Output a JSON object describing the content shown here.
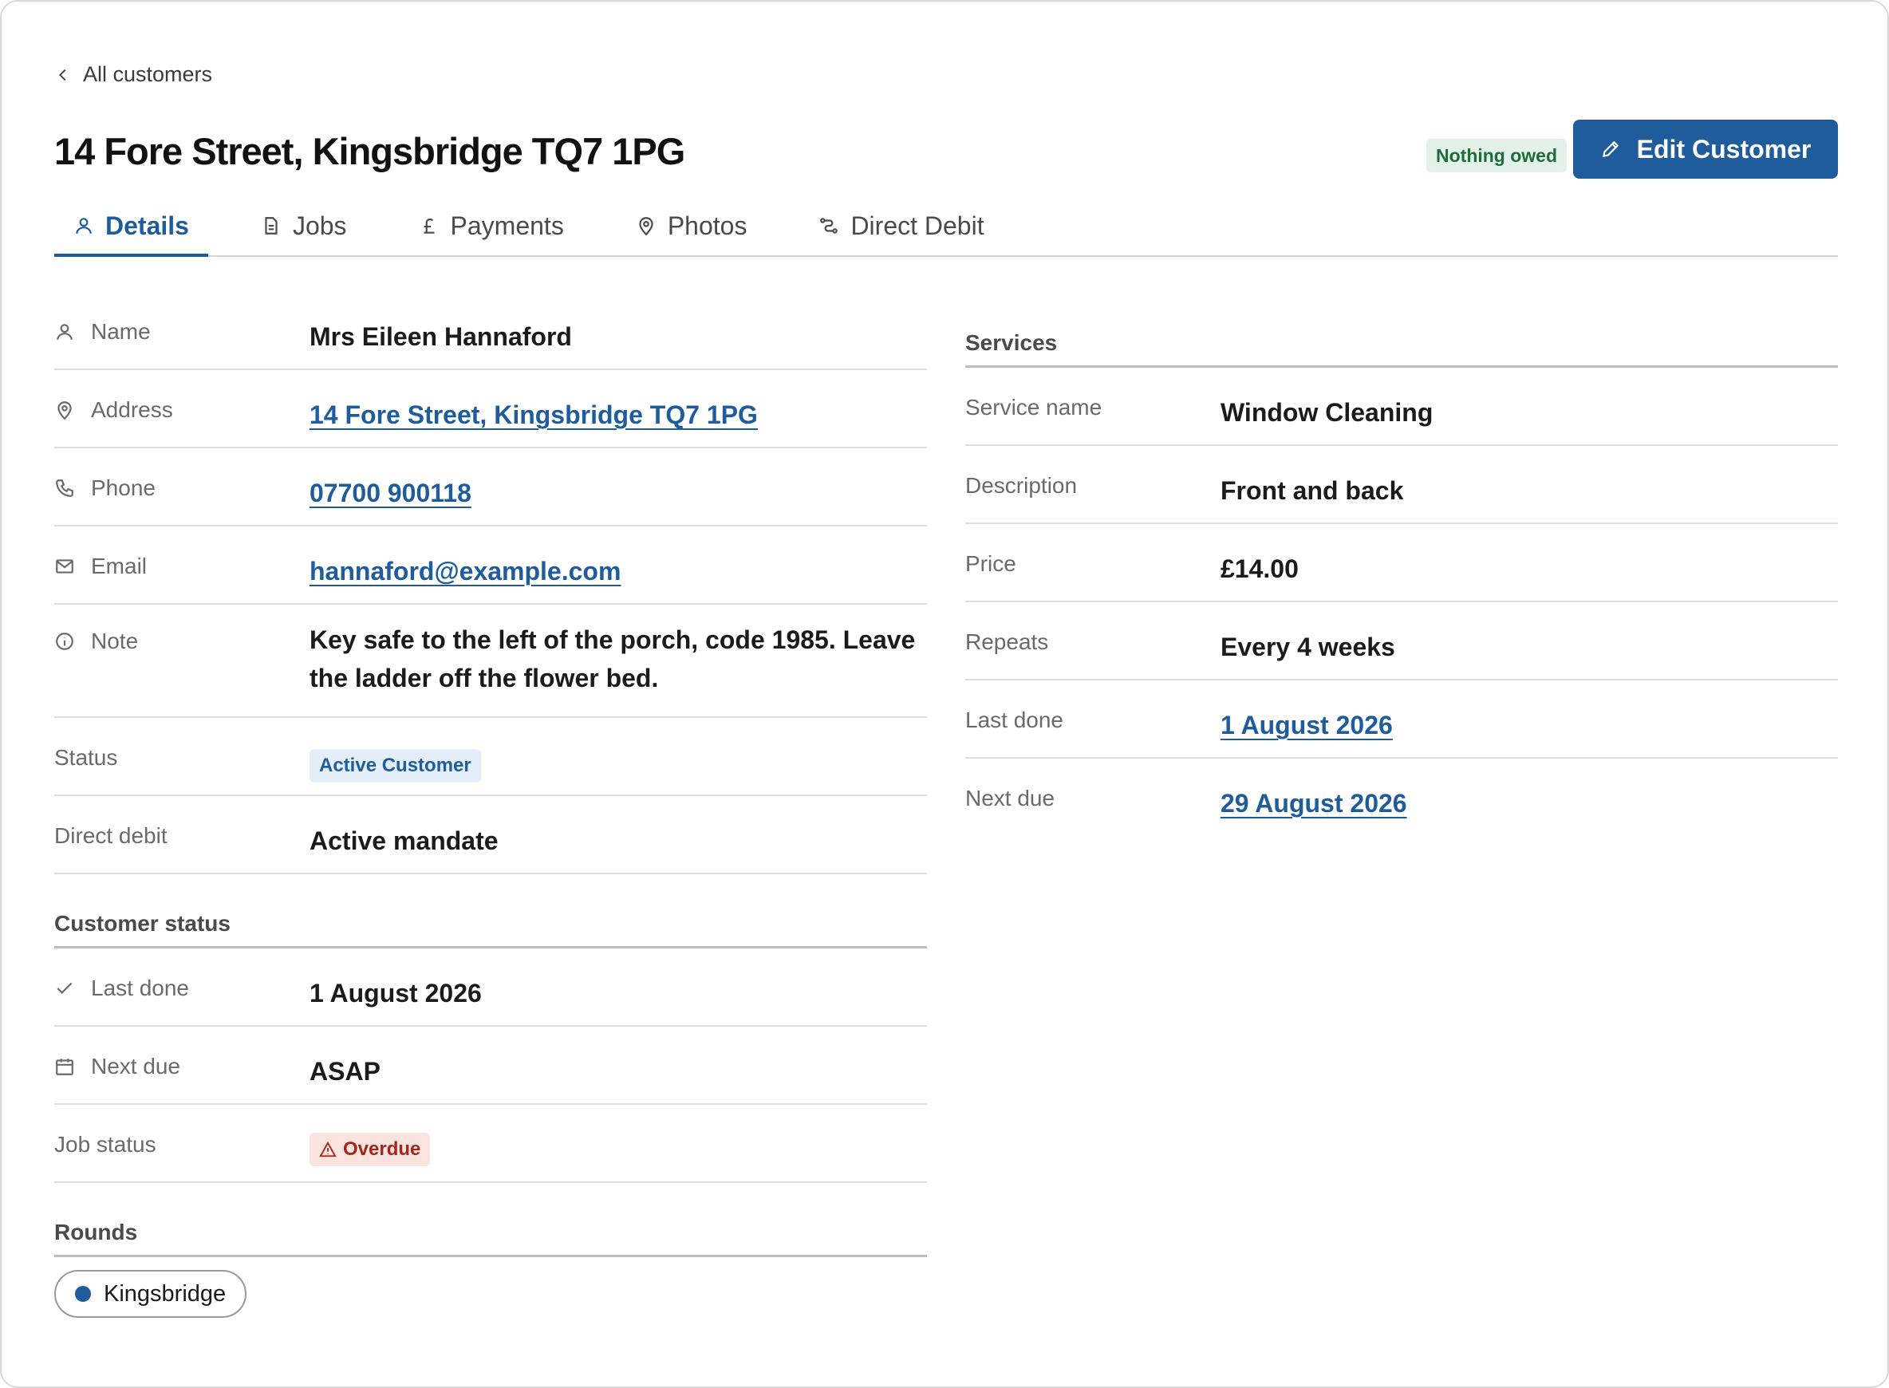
{
  "back": {
    "label": "All customers"
  },
  "header": {
    "title": "14 Fore Street, Kingsbridge TQ7 1PG",
    "balance_badge": "Nothing owed",
    "edit_label": "Edit Customer"
  },
  "tabs": [
    {
      "label": "Details",
      "icon": "person-icon",
      "active": true
    },
    {
      "label": "Jobs",
      "icon": "document-icon"
    },
    {
      "label": "Payments",
      "icon": "pound-icon"
    },
    {
      "label": "Photos",
      "icon": "location-pin-icon"
    },
    {
      "label": "Direct Debit",
      "icon": "route-icon"
    }
  ],
  "details": {
    "name": {
      "label": "Name",
      "value": "Mrs Eileen Hannaford"
    },
    "address": {
      "label": "Address",
      "value": "14 Fore Street, Kingsbridge TQ7 1PG"
    },
    "phone": {
      "label": "Phone",
      "value": "07700 900118"
    },
    "email": {
      "label": "Email",
      "value": "hannaford@example.com"
    },
    "note": {
      "label": "Note",
      "value": "Key safe to the left of the porch, code 1985. Leave the ladder off the flower bed."
    },
    "status": {
      "label": "Status",
      "value": "Active Customer"
    },
    "direct_debit": {
      "label": "Direct debit",
      "value": "Active mandate"
    }
  },
  "customer_status": {
    "heading": "Customer status",
    "last_done": {
      "label": "Last done",
      "value": "1 August 2026"
    },
    "next_due": {
      "label": "Next due",
      "value": "ASAP"
    },
    "job_status": {
      "label": "Job status",
      "value": "Overdue"
    }
  },
  "rounds": {
    "heading": "Rounds",
    "items": [
      "Kingsbridge"
    ],
    "dot_color": "#1f5c9b"
  },
  "services": {
    "heading": "Services",
    "service_name": {
      "label": "Service name",
      "value": "Window Cleaning"
    },
    "description": {
      "label": "Description",
      "value": "Front and back"
    },
    "price": {
      "label": "Price",
      "value": "£14.00"
    },
    "repeats": {
      "label": "Repeats",
      "value": "Every 4 weeks"
    },
    "last_done": {
      "label": "Last done",
      "value": "1 August 2026"
    },
    "next_due": {
      "label": "Next due",
      "value": "29 August 2026"
    }
  },
  "colors": {
    "accent": "#1f5c9b",
    "success_bg": "#e3f1e8",
    "success_text": "#1f6b3a",
    "danger_bg": "#fbe3df",
    "danger_text": "#a3261a"
  }
}
